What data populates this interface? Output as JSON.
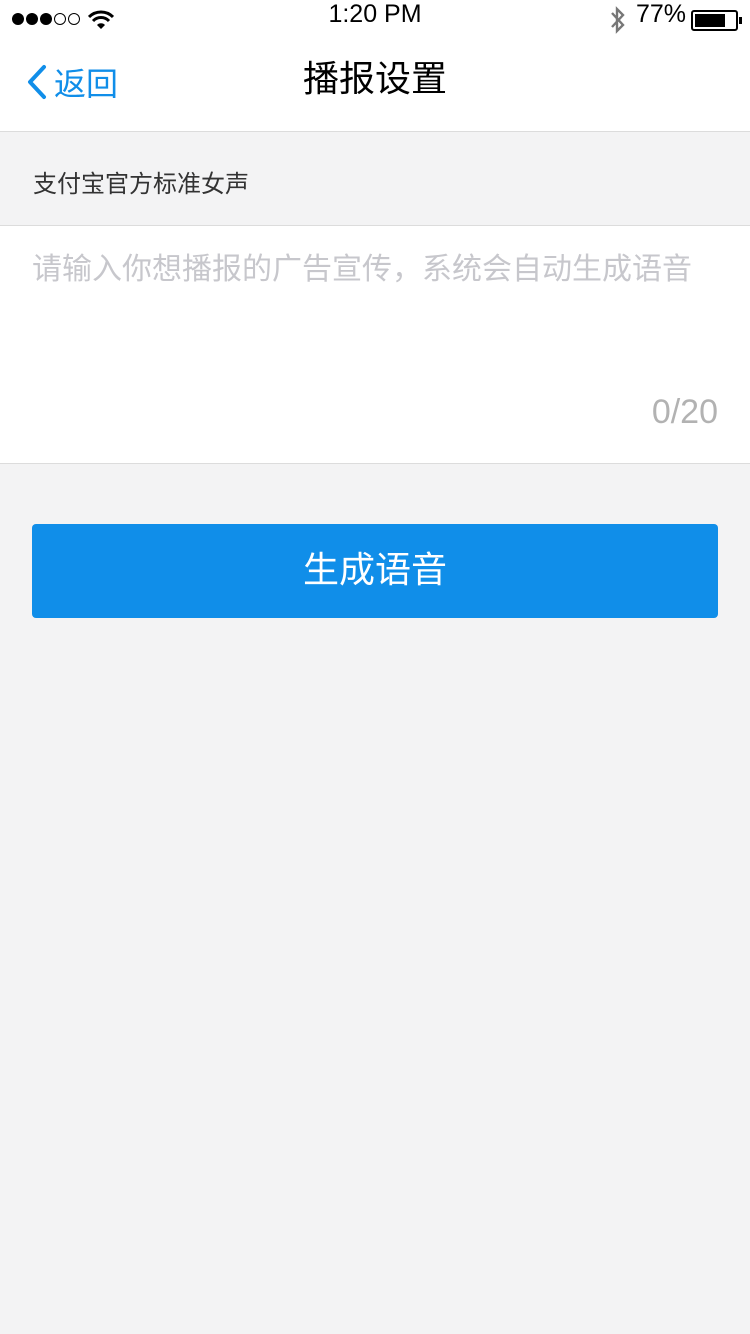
{
  "status_bar": {
    "signal_icon": "signal-dots-icon",
    "wifi_icon": "wifi-icon",
    "time": "1:20 PM",
    "bluetooth_icon": "bluetooth-icon",
    "battery_percent": "77%",
    "battery_level": 0.77
  },
  "nav": {
    "back_icon": "chevron-left-icon",
    "back_label": "返回",
    "title": "播报设置"
  },
  "voice": {
    "label": "支付宝官方标准女声"
  },
  "input": {
    "value": "",
    "placeholder": "请输入你想播报的广告宣传，系统会自动生成语音",
    "counter": "0/20"
  },
  "action": {
    "generate_label": "生成语音"
  },
  "colors": {
    "accent": "#108ee9",
    "background": "#f3f3f4",
    "placeholder": "#c7c7cc",
    "counter": "#b2b2b2"
  }
}
